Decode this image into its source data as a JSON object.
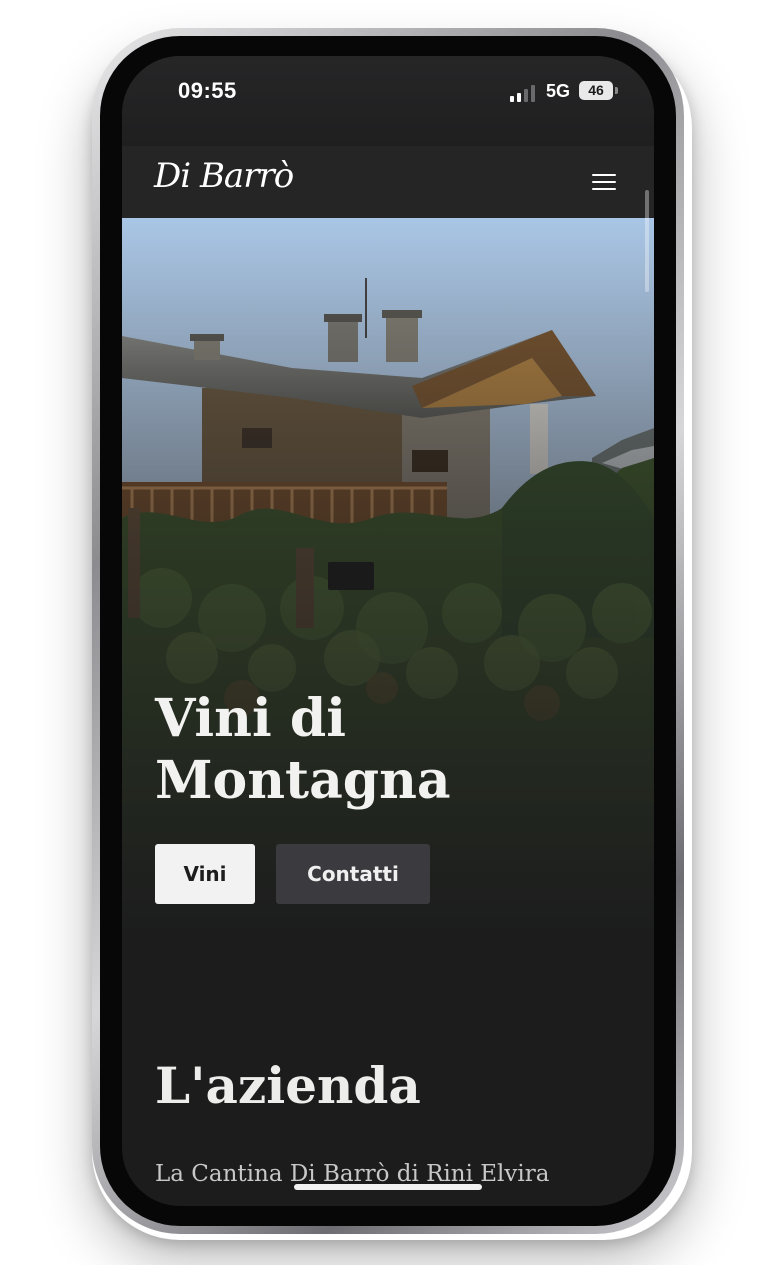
{
  "status_bar": {
    "time": "09:55",
    "network": "5G",
    "battery": "46"
  },
  "nav": {
    "logo": "Di Barrò",
    "menu_icon": "hamburger-menu-icon"
  },
  "hero": {
    "title": "Vini di Montagna",
    "image": "mountain-stone-chalet-with-vineyard",
    "buttons": {
      "vini": "Vini",
      "contatti": "Contatti"
    }
  },
  "about": {
    "title": "L'azienda",
    "text": "La Cantina Di Barrò di Rini Elvira"
  },
  "colors": {
    "background": "#1c1c1d",
    "nav": "#252526",
    "primary_button": "#f2f2f2",
    "secondary_button": "#3b3b3f",
    "text": "#f2f2f0"
  }
}
